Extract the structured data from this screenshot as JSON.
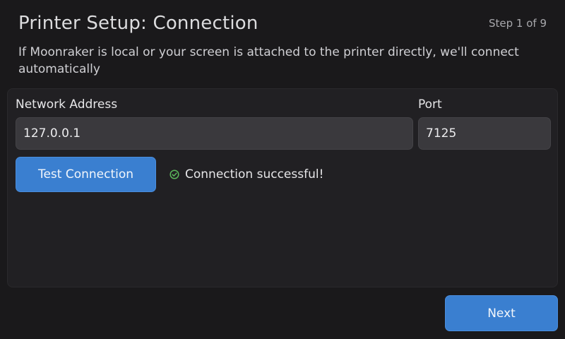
{
  "header": {
    "title": "Printer Setup: Connection",
    "step": "Step 1 of 9",
    "description": "If Moonraker is local or your screen is attached to the printer directly, we'll connect automatically"
  },
  "connection": {
    "address_label": "Network Address",
    "address_value": "127.0.0.1",
    "port_label": "Port",
    "port_value": "7125",
    "test_button_label": "Test Connection",
    "status_icon": "check-circle-icon",
    "status_text": "Connection successful!",
    "status_color": "#5cb85c"
  },
  "footer": {
    "next_label": "Next"
  },
  "colors": {
    "accent": "#3a7fd0",
    "background": "#1a191b",
    "panel": "#212023",
    "input": "#3a393d"
  }
}
